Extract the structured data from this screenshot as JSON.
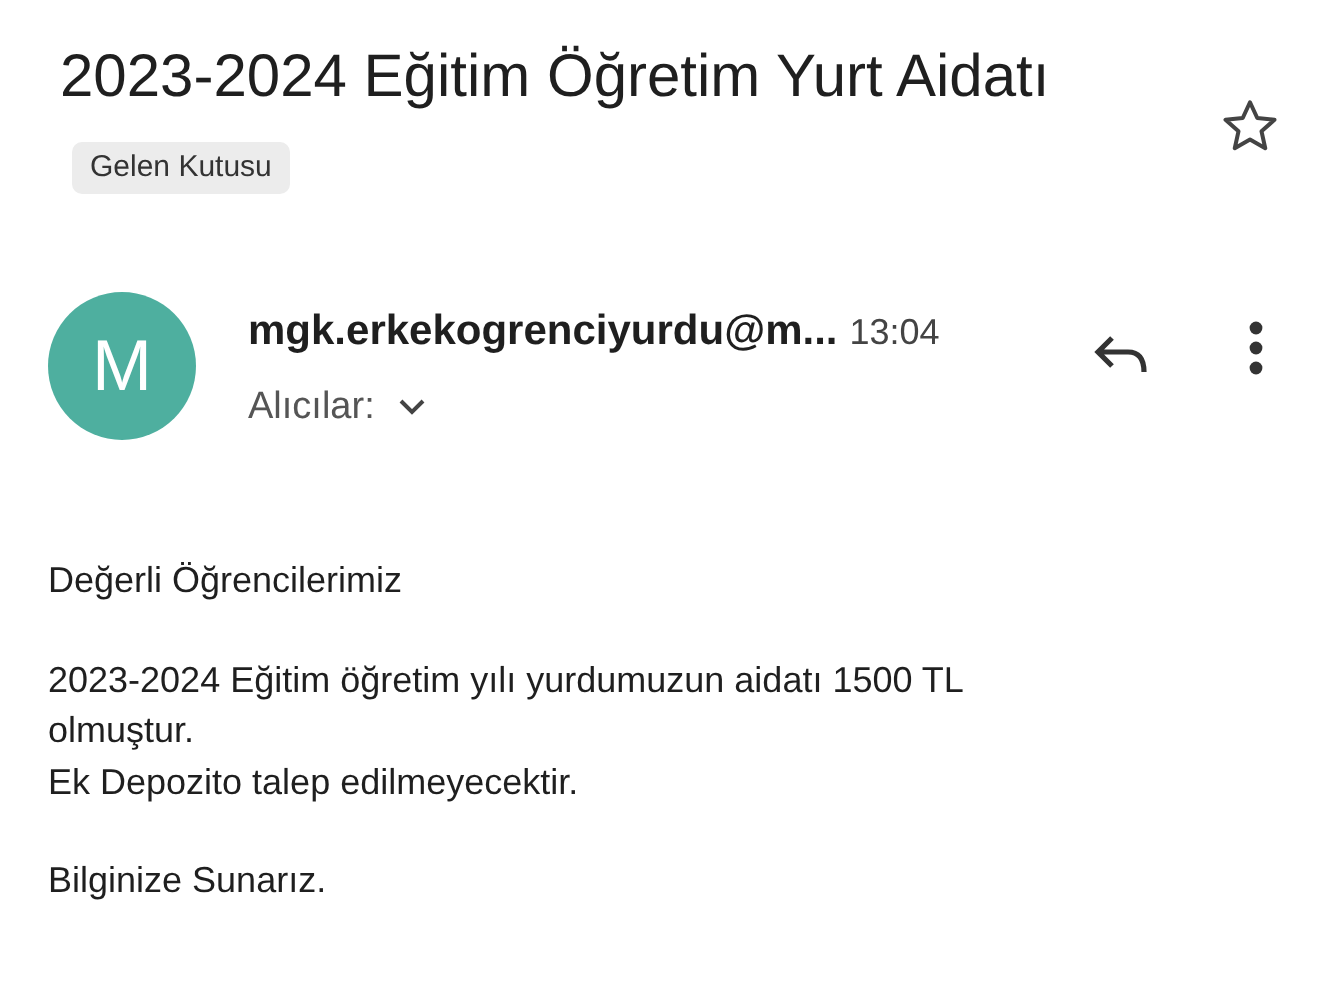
{
  "subject": "2023-2024 Eğitim Öğretim Yurt Aidatı",
  "label": "Gelen Kutusu",
  "starred": false,
  "sender": {
    "avatar_letter": "M",
    "address": "mgk.erkekogrenciyurdu@m...",
    "time": "13:04",
    "recipients_label": "Alıcılar:"
  },
  "body": [
    [
      "Değerli Öğrencilerimiz"
    ],
    [
      "2023-2024 Eğitim öğretim yılı yurdumuzun aidatı 1500 TL olmuştur.",
      "Ek Depozito talep edilmeyecektir."
    ],
    [
      "Bilginize Sunarız."
    ]
  ]
}
